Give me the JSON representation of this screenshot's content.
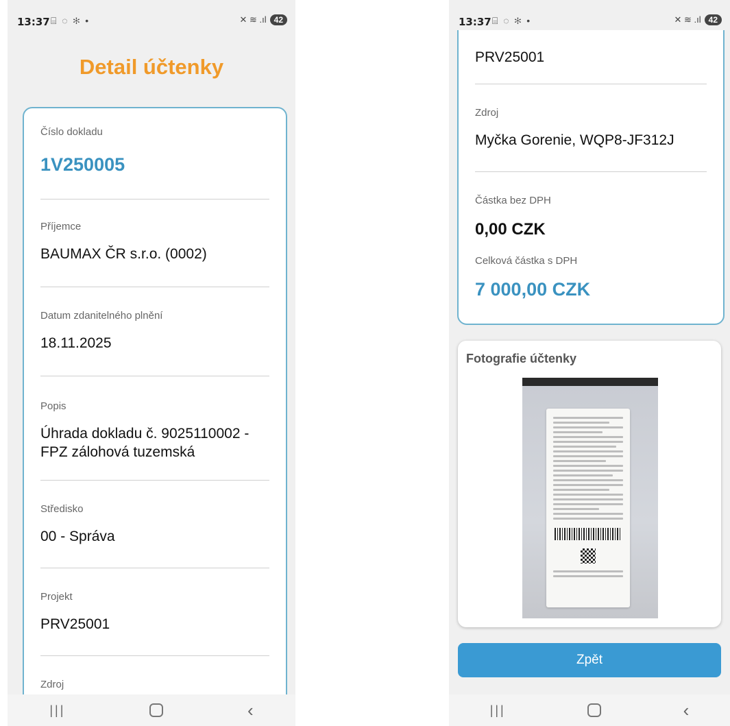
{
  "status": {
    "time": "13:37",
    "icons_left": "⌸ ◌ ✻ •",
    "icons_right": "✕ ≋ .ıl",
    "battery": "42"
  },
  "page_title": "Detail účtenky",
  "fields": {
    "cislo_dokladu": {
      "label": "Číslo dokladu",
      "value": "1V250005"
    },
    "prijemce": {
      "label": "Příjemce",
      "value": "BAUMAX ČR s.r.o. (0002)"
    },
    "datum": {
      "label": "Datum zdanitelného plnění",
      "value": "18.11.2025"
    },
    "popis": {
      "label": "Popis",
      "value": "Úhrada dokladu č. 9025110002 - FPZ zálohová tuzemská"
    },
    "stredisko": {
      "label": "Středisko",
      "value": "00 - Správa"
    },
    "projekt": {
      "label": "Projekt",
      "value": "PRV25001"
    },
    "zdroj": {
      "label": "Zdroj",
      "value": "Myčka Gorenie, WQP8-JF312J"
    },
    "castka_bez_dph": {
      "label": "Částka bez DPH",
      "value": "0,00 CZK"
    },
    "celkova_castka": {
      "label": "Celková částka s DPH",
      "value": "7 000,00 CZK"
    }
  },
  "photo": {
    "title": "Fotografie účtenky"
  },
  "back_button": "Zpět",
  "colors": {
    "accent_orange": "#f09a2a",
    "accent_blue": "#3a92c0",
    "button_blue": "#3a9ad3",
    "card_border": "#6fb3cf"
  }
}
